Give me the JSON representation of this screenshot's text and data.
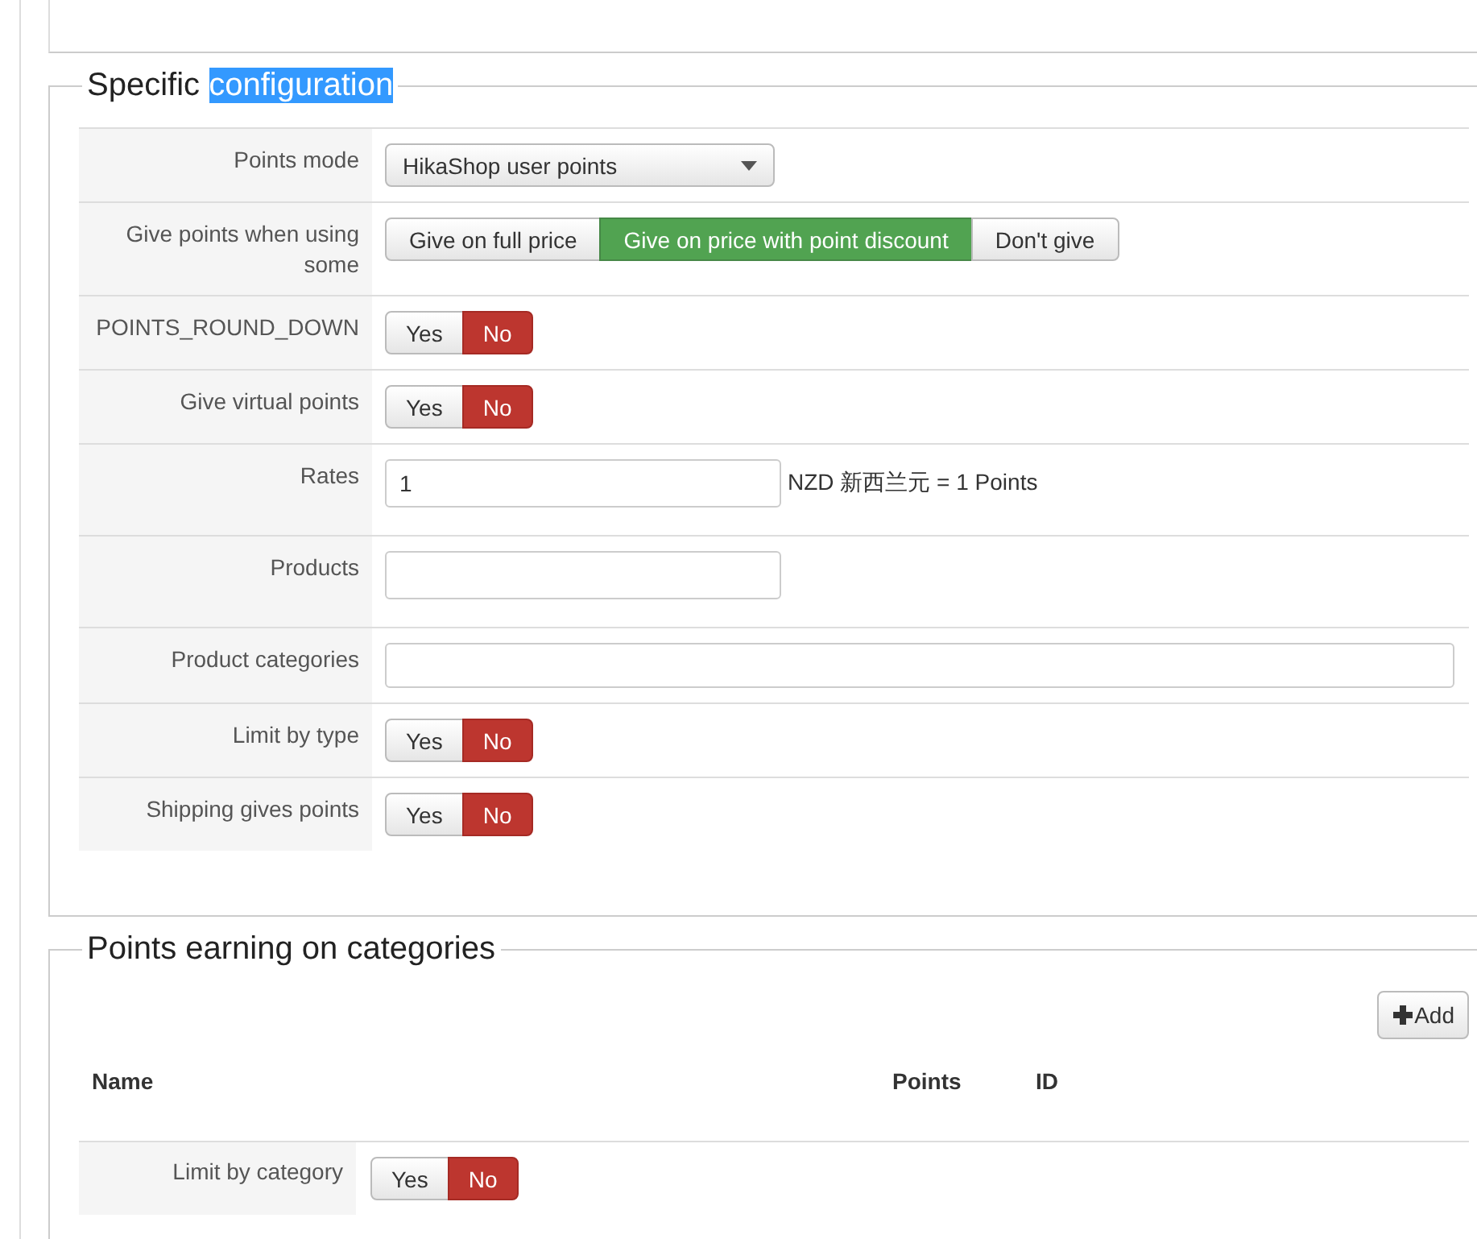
{
  "specific_configuration": {
    "legend": [
      {
        "text": "Specific",
        "selected": false
      },
      {
        "text": "configuration",
        "selected": true
      }
    ],
    "rows": [
      {
        "label": "Points mode",
        "kind": "select",
        "value": "HikaShop user points"
      },
      {
        "label": "Give points when using some",
        "kind": "choice",
        "options": [
          {
            "label": "Give on full price",
            "selected": false
          },
          {
            "label": "Give on price with point discount",
            "selected": true
          },
          {
            "label": "Don't give",
            "selected": false
          }
        ]
      },
      {
        "label": "POINTS_ROUND_DOWN",
        "kind": "yesno",
        "options": [
          {
            "label": "Yes",
            "selected": false
          },
          {
            "label": "No",
            "selected": true
          }
        ]
      },
      {
        "label": "Give virtual points",
        "kind": "yesno",
        "options": [
          {
            "label": "Yes",
            "selected": false
          },
          {
            "label": "No",
            "selected": true
          }
        ]
      },
      {
        "label": "Rates",
        "kind": "short_input",
        "value": "1",
        "suffix": "NZD 新西兰元 = 1 Points"
      },
      {
        "label": "Products",
        "kind": "short_input"
      },
      {
        "label": "Product categories",
        "kind": "long_input"
      },
      {
        "label": "Limit by type",
        "kind": "yesno",
        "options": [
          {
            "label": "Yes",
            "selected": false
          },
          {
            "label": "No",
            "selected": true
          }
        ]
      },
      {
        "label": "Shipping gives points",
        "kind": "yesno",
        "options": [
          {
            "label": "Yes",
            "selected": false
          },
          {
            "label": "No",
            "selected": true
          }
        ]
      }
    ]
  },
  "points_earning_on_categories": {
    "legend": "Points earning on categories",
    "add_button": "Add",
    "columns": [
      "Name",
      "Points",
      "ID"
    ],
    "limit_row": {
      "label": "Limit by category",
      "options": [
        {
          "label": "Yes",
          "selected": false
        },
        {
          "label": "No",
          "selected": true
        }
      ]
    }
  }
}
